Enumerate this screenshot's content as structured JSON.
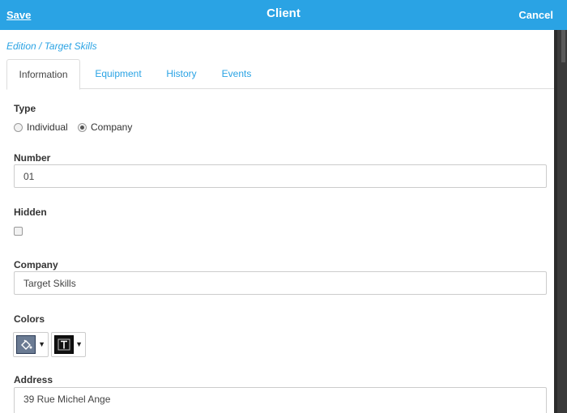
{
  "header": {
    "save_label": "Save",
    "title": "Client",
    "cancel_label": "Cancel",
    "background": "#2aa3e4"
  },
  "breadcrumb": "Edition / Target Skills",
  "tabs": [
    {
      "label": "Information",
      "active": true
    },
    {
      "label": "Equipment",
      "active": false
    },
    {
      "label": "History",
      "active": false
    },
    {
      "label": "Events",
      "active": false
    }
  ],
  "form": {
    "type": {
      "label": "Type",
      "options": [
        {
          "label": "Individual",
          "checked": false
        },
        {
          "label": "Company",
          "checked": true
        }
      ]
    },
    "number": {
      "label": "Number",
      "value": "01"
    },
    "hidden": {
      "label": "Hidden",
      "checked": false
    },
    "company": {
      "label": "Company",
      "value": "Target Skills"
    },
    "colors": {
      "label": "Colors",
      "pickers": [
        {
          "icon": "paint-bucket-icon",
          "swatch_color": "#6b7b93"
        },
        {
          "icon": "text-color-icon",
          "swatch_color": "#111111"
        }
      ],
      "caret": "▼"
    },
    "address": {
      "label": "Address",
      "value": "39 Rue Michel Ange"
    }
  }
}
